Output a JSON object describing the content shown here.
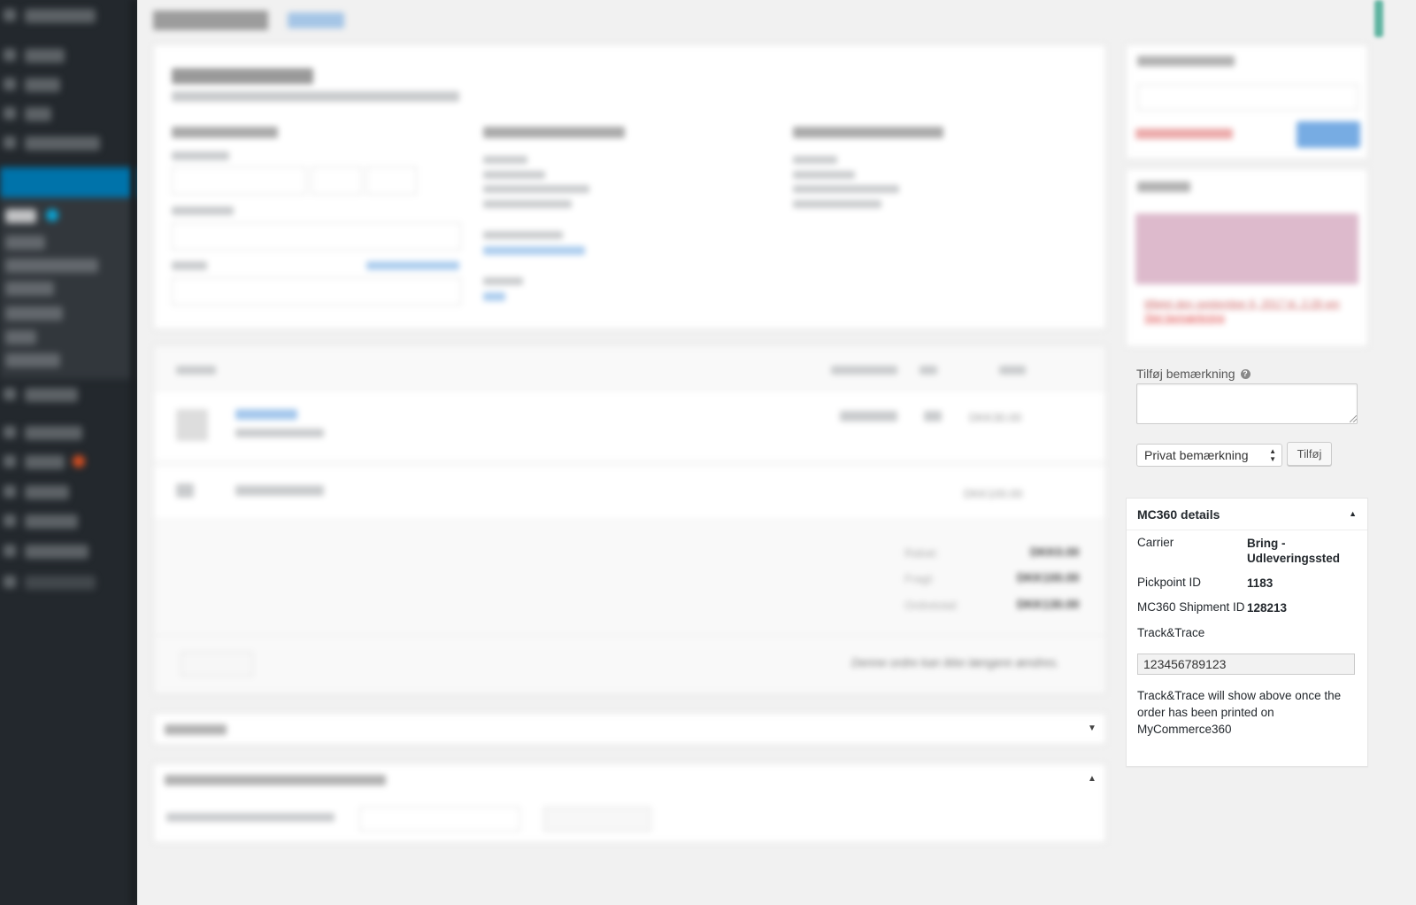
{
  "order_items": {
    "line_cost": "DKK30.00",
    "shipping_cost": "DKK100.00"
  },
  "totals": {
    "discount_label": "Rabat:",
    "discount_value": "DKK0.00",
    "shipping_label": "Fragt:",
    "shipping_value": "DKK100.00",
    "order_total_label": "Ordretotal:",
    "order_total_value": "DKK130.00",
    "locked_notice": "Denne ordre kan ikke længere ændres."
  },
  "notes": {
    "added_on": "tilføjet den september 6, 2017 kl. 2:28 pm",
    "delete_link": "Slet bemærkning",
    "add_note_label": "Tilføj bemærkning",
    "help_icon": "help-icon",
    "note_text": "",
    "note_type_selected": "Privat bemærkning",
    "add_button": "Tilføj"
  },
  "mc360": {
    "title": "MC360 details",
    "carrier_label": "Carrier",
    "carrier_value": "Bring - Udleveringssted",
    "pickpoint_label": "Pickpoint ID",
    "pickpoint_value": "1183",
    "shipment_label": "MC360 Shipment ID",
    "shipment_value": "128213",
    "tracktrace_label": "Track&Trace",
    "tracktrace_value": "123456789123",
    "tracktrace_note": "Track&Trace will show above once the order has been printed on MyCommerce360"
  },
  "colors": {
    "sidebar_bg": "#23282d",
    "accent": "#0073aa",
    "page_bg": "#f1f1f1",
    "note_pink": "#d9b3c6"
  }
}
